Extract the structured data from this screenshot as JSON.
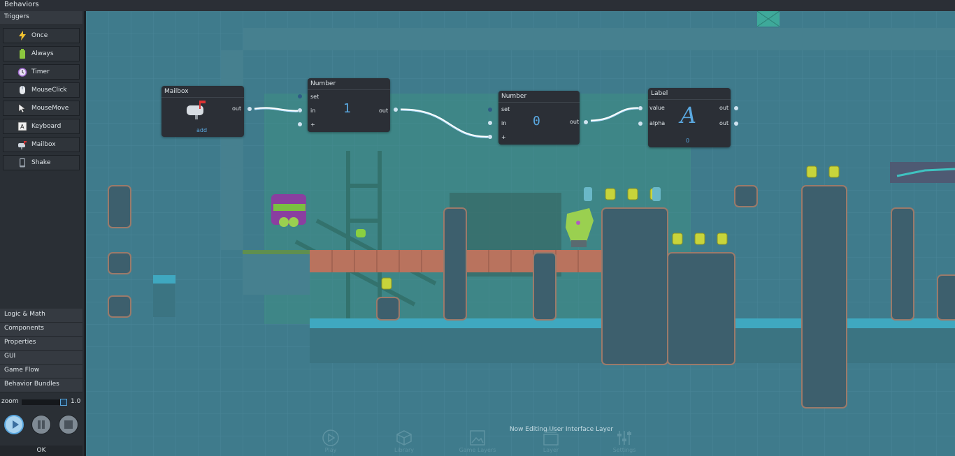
{
  "topbar": {
    "title": "Behaviors"
  },
  "sidebar": {
    "triggers_header": "Triggers",
    "triggers": [
      {
        "label": "Once",
        "icon": "lightning-icon"
      },
      {
        "label": "Always",
        "icon": "battery-icon"
      },
      {
        "label": "Timer",
        "icon": "alarm-clock-icon"
      },
      {
        "label": "MouseClick",
        "icon": "mouse-icon"
      },
      {
        "label": "MouseMove",
        "icon": "cursor-icon"
      },
      {
        "label": "Keyboard",
        "icon": "key-icon"
      },
      {
        "label": "Mailbox",
        "icon": "mailbox-icon"
      },
      {
        "label": "Shake",
        "icon": "phone-icon"
      }
    ],
    "categories": [
      "Logic & Math",
      "Components",
      "Properties",
      "GUI",
      "Game Flow",
      "Behavior Bundles"
    ],
    "zoom_label": "zoom",
    "zoom_value": "1.0",
    "ok_label": "OK"
  },
  "nodes": {
    "mailbox": {
      "title": "Mailbox",
      "out": "out",
      "add": "add"
    },
    "number1": {
      "title": "Number",
      "set": "set",
      "in": "in",
      "plus": "+",
      "value": "1",
      "out": "out"
    },
    "number2": {
      "title": "Number",
      "set": "set",
      "in": "in",
      "plus": "+",
      "value": "0",
      "out": "out"
    },
    "label": {
      "title": "Label",
      "value": "value",
      "alpha": "alpha",
      "out1": "out",
      "out2": "out",
      "glyph": "A",
      "num": "0"
    }
  },
  "canvas": {
    "hint": "Now Editing User Interface Layer",
    "footer_tools": [
      "Play",
      "Library",
      "Game Layers",
      "Layer",
      "Settings"
    ]
  },
  "colors": {
    "accent": "#5aa8e0",
    "wire": "#ffffff",
    "tile_blue": "#3fa8c0",
    "brick": "#b9735e"
  }
}
